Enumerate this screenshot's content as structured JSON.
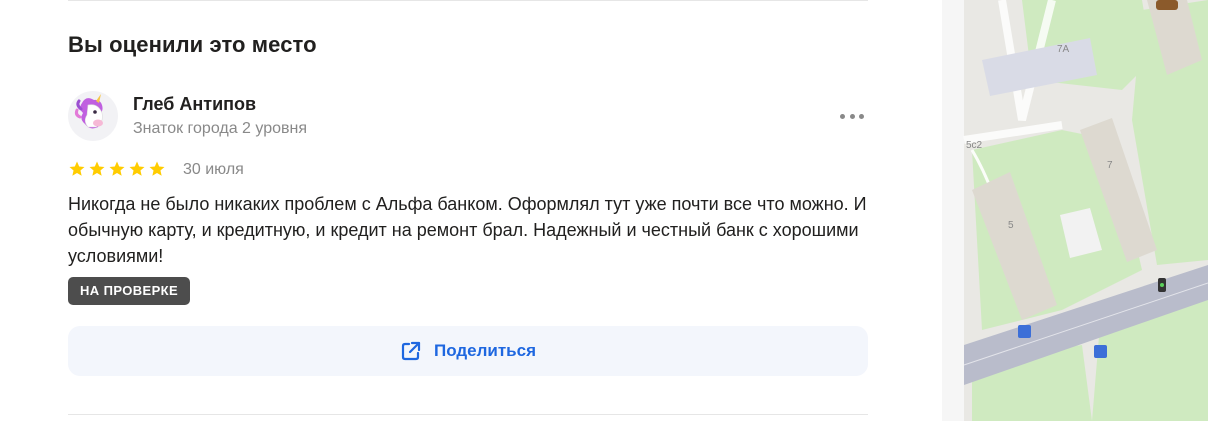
{
  "review_section": {
    "title": "Вы оценили это место",
    "author": {
      "name": "Глеб Антипов",
      "level": "Знаток города 2 уровня",
      "avatar_icon": "unicorn-icon"
    },
    "rating": 5,
    "date": "30 июля",
    "text": "Никогда не было никаких проблем с Альфа банком. Оформлял тут уже почти все что можно. И обычную карту, и кредитную, и кредит на ремонт брал. Надежный и честный банк с хорошими условиями!",
    "badge": "НА ПРОВЕРКЕ",
    "share_label": "Поделиться",
    "more_icon": "more-dots-icon",
    "share_icon": "external-share-icon"
  },
  "map": {
    "building_labels": [
      "7А",
      "5с2",
      "7",
      "5"
    ]
  },
  "colors": {
    "star": "#fc0",
    "accent": "#1e67e0",
    "badge_bg": "#4d4d4d",
    "share_bg": "#f3f6fc"
  }
}
